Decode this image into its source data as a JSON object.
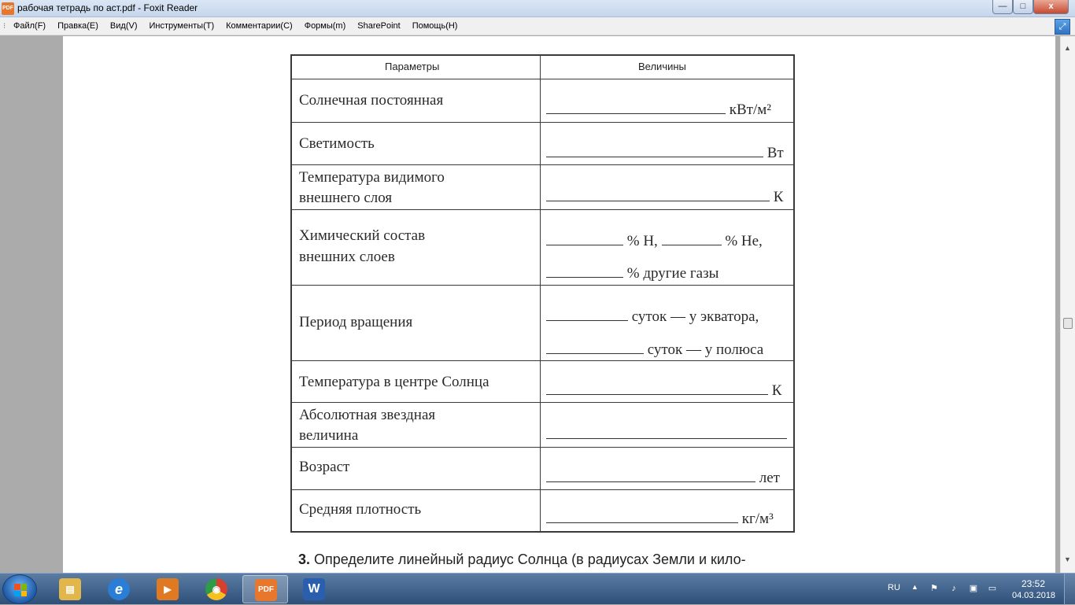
{
  "window": {
    "title": "рабочая тетрадь по аст.pdf - Foxit Reader",
    "icon_label": "PDF",
    "min_glyph": "—",
    "max_glyph": "□",
    "close_glyph": "x"
  },
  "menu": {
    "grip": "⁝",
    "items": [
      {
        "label": "Файл(F)"
      },
      {
        "label": "Правка(E)"
      },
      {
        "label": "Вид(V)"
      },
      {
        "label": "Инструменты(T)"
      },
      {
        "label": "Комментарии(C)"
      },
      {
        "label": "Формы(m)"
      },
      {
        "label": "SharePoint"
      },
      {
        "label": "Помощь(H)"
      }
    ],
    "fullscreen_glyph": "⤢"
  },
  "scrollbar": {
    "up_glyph": "▲",
    "down_glyph": "▼"
  },
  "table": {
    "headers": {
      "param": "Параметры",
      "value": "Величины"
    },
    "rows": [
      {
        "param_lines": [
          "Солнечная постоянная"
        ],
        "unit": "кВт/м²"
      },
      {
        "param_lines": [
          "Светимость"
        ],
        "unit": "Вт"
      },
      {
        "param_lines": [
          "Температура видимого",
          "внешнего слоя"
        ],
        "unit": "К"
      },
      {
        "param_lines": [
          "Химический состав",
          "внешних слоев"
        ],
        "parts": [
          "% H,",
          "% He,",
          "% другие газы"
        ]
      },
      {
        "param_lines": [
          "Период вращения"
        ],
        "parts": [
          "суток — у экватора,",
          "суток — у полюса"
        ]
      },
      {
        "param_lines": [
          "Температура в центре Солнца"
        ],
        "unit": "К"
      },
      {
        "param_lines": [
          "Абсолютная звездная",
          "величина"
        ],
        "unit": ""
      },
      {
        "param_lines": [
          "Возраст"
        ],
        "unit": "лет"
      },
      {
        "param_lines": [
          "Средняя плотность"
        ],
        "unit": "кг/м³"
      }
    ]
  },
  "next_task": {
    "number": "3.",
    "text": "Определите линейный радиус Солнца (в радиусах Земли и кило-"
  },
  "taskbar": {
    "apps": [
      {
        "name": "explorer-app",
        "glyph": "▤",
        "color": "#e2b64a"
      },
      {
        "name": "ie-app",
        "glyph": "e",
        "color": "#2a7ed6"
      },
      {
        "name": "media-app",
        "glyph": "▶",
        "color": "#e07a22"
      },
      {
        "name": "chrome-app",
        "glyph": "◉",
        "color": "#d8402e"
      },
      {
        "name": "foxit-app",
        "glyph": "PDF",
        "color": "#e8772e"
      },
      {
        "name": "word-app",
        "glyph": "W",
        "color": "#2a5fb0"
      }
    ],
    "lang": "RU",
    "tray_arrow": "▲",
    "time": "23:52",
    "date": "04.03.2018"
  },
  "colors": {
    "accent": "#e8772e",
    "taskbar": "#2e4f78",
    "page": "#ffffff",
    "desk": "#ababab"
  }
}
